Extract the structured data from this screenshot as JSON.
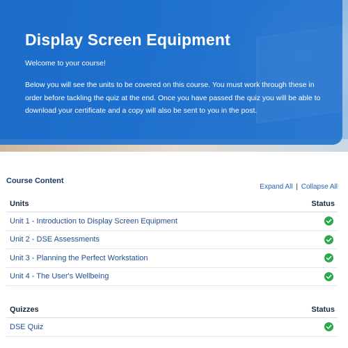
{
  "hero": {
    "title": "Display Screen Equipment",
    "welcome": "Welcome to your course!",
    "intro": "Below you will see the units to be covered on this course. You must work through these in order before tackling the quiz at the end. Once you have passed the quiz you will be able to download your certificate and a copy will also be sent to you in the post."
  },
  "course_content": {
    "title": "Course Content",
    "expand_all": "Expand All",
    "separator": "|",
    "collapse_all": "Collapse All"
  },
  "units": {
    "header": "Units",
    "status_header": "Status",
    "items": [
      {
        "label": "Unit 1 - Introduction to Display Screen Equipment",
        "status": "complete"
      },
      {
        "label": "Unit 2 - DSE Assessments",
        "status": "complete"
      },
      {
        "label": "Unit 3 - Planning the Perfect Workstation",
        "status": "complete"
      },
      {
        "label": "Unit 4 - The User's Wellbeing",
        "status": "complete"
      }
    ]
  },
  "quizzes": {
    "header": "Quizzes",
    "status_header": "Status",
    "items": [
      {
        "label": "DSE Quiz",
        "status": "complete"
      }
    ]
  },
  "colors": {
    "accent": "#1d6ecd",
    "status_complete": "#2aa84a",
    "link": "#1f4f8f"
  },
  "icons": {
    "status_complete": "check-circle-icon"
  }
}
